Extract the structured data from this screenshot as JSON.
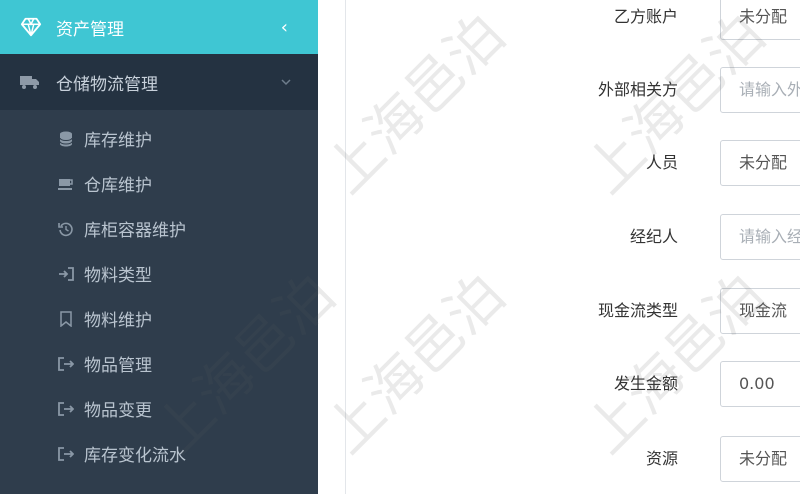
{
  "sidebar": {
    "top": {
      "label": "资产管理",
      "icon": "gem-icon"
    },
    "sub": {
      "label": "仓储物流管理",
      "icon": "truck-icon"
    },
    "items": [
      {
        "label": "库存维护",
        "icon": "database-icon"
      },
      {
        "label": "仓库维护",
        "icon": "cup-icon"
      },
      {
        "label": "库柜容器维护",
        "icon": "history-icon"
      },
      {
        "label": "物料类型",
        "icon": "sign-in-icon"
      },
      {
        "label": "物料维护",
        "icon": "bookmark-icon"
      },
      {
        "label": "物品管理",
        "icon": "sign-out-icon"
      },
      {
        "label": "物品变更",
        "icon": "sign-out-icon"
      },
      {
        "label": "库存变化流水",
        "icon": "sign-out-icon"
      }
    ]
  },
  "form": {
    "fields": [
      {
        "label": "乙方账户",
        "value": "未分配",
        "placeholder": ""
      },
      {
        "label": "外部相关方",
        "value": "",
        "placeholder": "请输入外"
      },
      {
        "label": "人员",
        "value": "未分配",
        "placeholder": ""
      },
      {
        "label": "经纪人",
        "value": "",
        "placeholder": "请输入经"
      },
      {
        "label": "现金流类型",
        "value": "现金流",
        "placeholder": ""
      },
      {
        "label": "发生金额",
        "value": "0.00",
        "placeholder": ""
      },
      {
        "label": "资源",
        "value": "未分配",
        "placeholder": ""
      }
    ]
  },
  "watermark": "上海邑泊",
  "colors": {
    "accent": "#3fc6d3",
    "sidebar_bg": "#2f3d4c",
    "sidebar_sub_bg": "#243241"
  }
}
